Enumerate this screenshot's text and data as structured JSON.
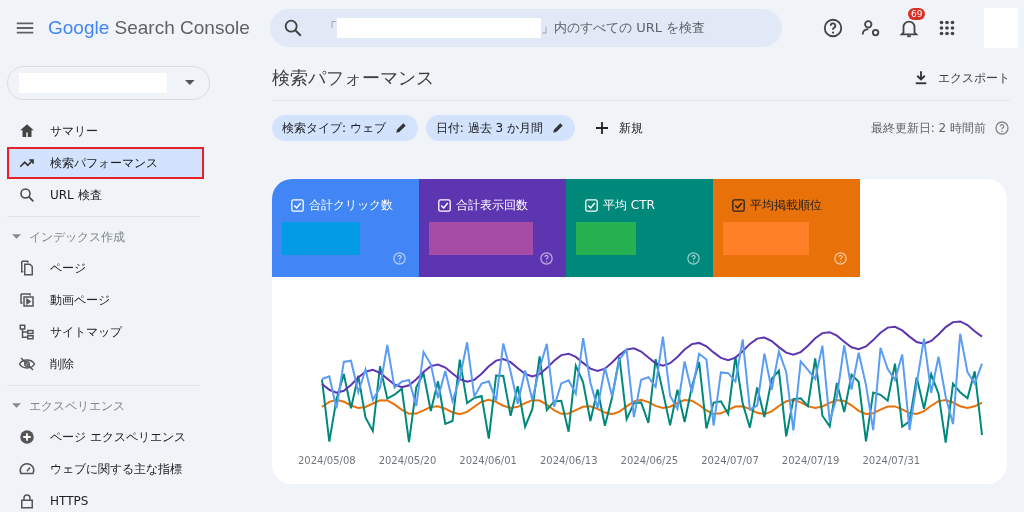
{
  "app": {
    "title_brand": "Google",
    "title_product": "Search Console"
  },
  "search": {
    "prefix": "「",
    "suffix": "」内のすべての URL を検査"
  },
  "notifications": {
    "count": "69"
  },
  "sidebar": {
    "items": [
      {
        "label": "サマリー",
        "selected": false,
        "outlined": false
      },
      {
        "label": "検索パフォーマンス",
        "selected": true,
        "outlined": true
      },
      {
        "label": "URL 検査",
        "selected": false,
        "outlined": false
      }
    ],
    "sections": [
      {
        "title": "インデックス作成",
        "expanded": true,
        "children": [
          {
            "label": "ページ",
            "selected": false
          },
          {
            "label": "動画ページ",
            "selected": false
          },
          {
            "label": "サイトマップ",
            "selected": false
          },
          {
            "label": "削除",
            "selected": false
          }
        ]
      },
      {
        "title": "エクスペリエンス",
        "expanded": true,
        "children": [
          {
            "label": "ページ エクスペリエンス",
            "selected": false
          },
          {
            "label": "ウェブに関する主な指標",
            "selected": false
          },
          {
            "label": "HTTPS",
            "selected": false
          }
        ]
      }
    ]
  },
  "page": {
    "title": "検索パフォーマンス",
    "export": "エクスポート"
  },
  "filters": [
    {
      "label": "検索タイプ: ウェブ"
    },
    {
      "label": "日付: 過去 3 か月間"
    }
  ],
  "new_filter": "新規",
  "updated": "最終更新日: 2 時間前",
  "metrics": [
    {
      "label": "合計クリック数",
      "checked": true,
      "color": "#4285f4"
    },
    {
      "label": "合計表示回数",
      "checked": true,
      "color": "#5e35b1"
    },
    {
      "label": "平均 CTR",
      "checked": true,
      "color": "#00897b"
    },
    {
      "label": "平均掲載順位",
      "checked": true,
      "color": "#e8710a"
    }
  ],
  "chart": {
    "x_labels": [
      "2024/05/08",
      "2024/05/20",
      "2024/06/01",
      "2024/06/13",
      "2024/06/25",
      "2024/07/07",
      "2024/07/19",
      "2024/07/31"
    ]
  }
}
